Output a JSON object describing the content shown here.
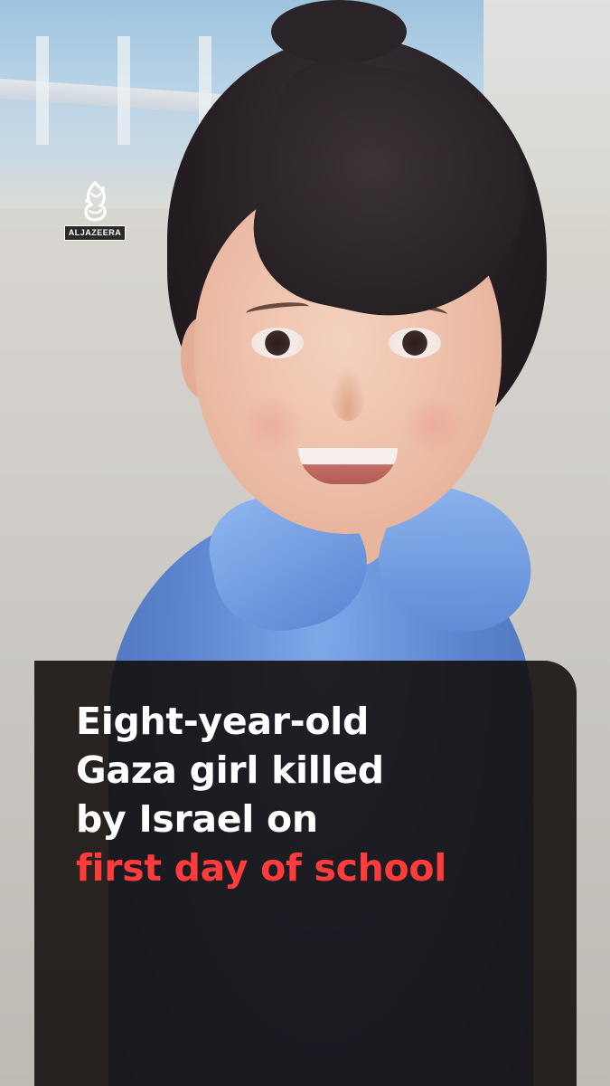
{
  "logo": {
    "wordmark": "ALJAZEERA",
    "icon": "al-jazeera-calligraphy-logo"
  },
  "headline": {
    "lines": [
      "Eight-year-old",
      "Gaza girl killed",
      "by Israel on"
    ],
    "highlight": "first day of school"
  },
  "colors": {
    "highlight": "#ff3b3b",
    "headline_text": "#ffffff",
    "card_background": "#120c0a",
    "shirt": "#5d86cf"
  }
}
